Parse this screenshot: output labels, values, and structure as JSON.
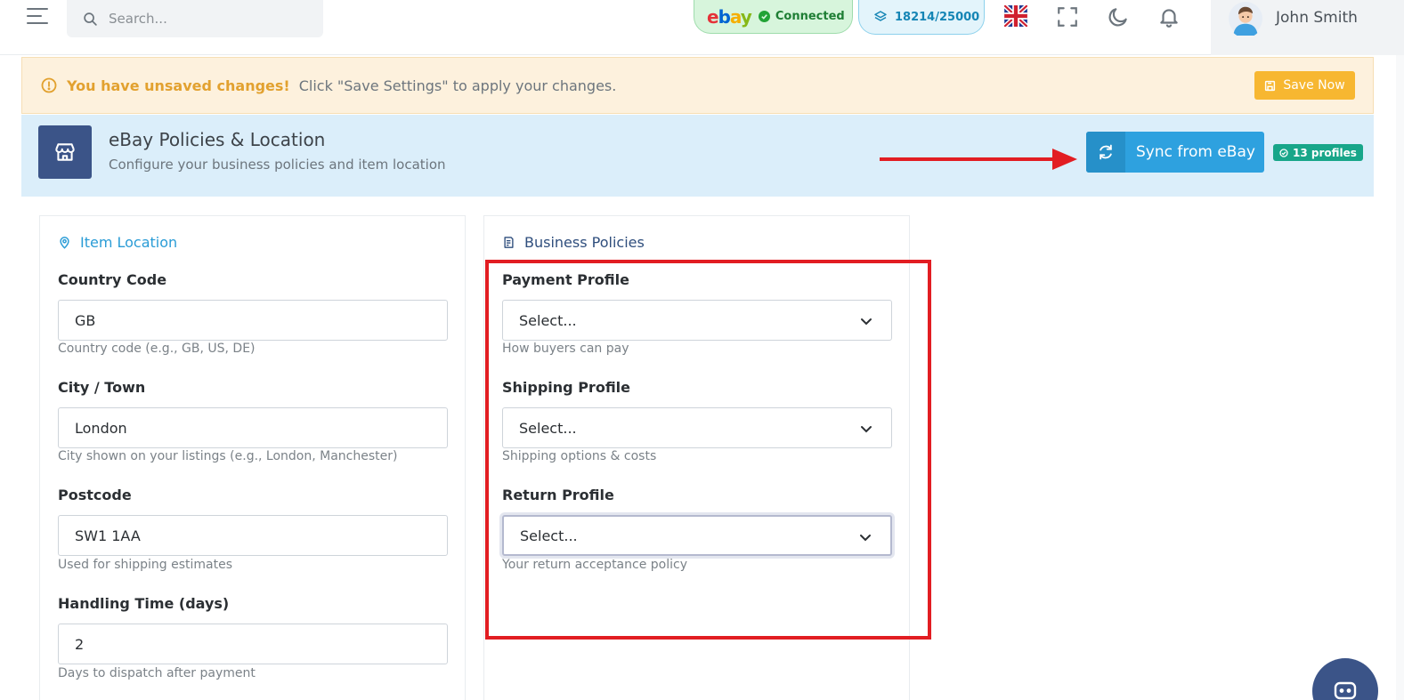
{
  "topbar": {
    "search_placeholder": "Search...",
    "ebay_brand": {
      "e": "e",
      "b": "b",
      "a": "a",
      "y": "y"
    },
    "connection_status": "Connected",
    "quota": "18214/25000",
    "user_name": "John Smith"
  },
  "alert": {
    "strong": "You have unsaved changes!",
    "text": "Click \"Save Settings\" to apply your changes.",
    "save_label": "Save Now"
  },
  "header": {
    "title": "eBay Policies & Location",
    "subtitle": "Configure your business policies and item location",
    "sync_label": "Sync from eBay",
    "profiles_badge": "13 profiles"
  },
  "item_location": {
    "title": "Item Location",
    "fields": [
      {
        "label": "Country Code",
        "value": "GB",
        "help": "Country code (e.g., GB, US, DE)"
      },
      {
        "label": "City / Town",
        "value": "London",
        "help": "City shown on your listings (e.g., London, Manchester)"
      },
      {
        "label": "Postcode",
        "value": "SW1 1AA",
        "help": "Used for shipping estimates"
      },
      {
        "label": "Handling Time (days)",
        "value": "2",
        "help": "Days to dispatch after payment"
      }
    ]
  },
  "business_policies": {
    "title": "Business Policies",
    "fields": [
      {
        "label": "Payment Profile",
        "value": "Select...",
        "help": "How buyers can pay"
      },
      {
        "label": "Shipping Profile",
        "value": "Select...",
        "help": "Shipping options & costs"
      },
      {
        "label": "Return Profile",
        "value": "Select...",
        "help": "Your return acceptance policy"
      }
    ]
  },
  "colors": {
    "accent": "#2ea1df",
    "brand_dark": "#3b5488",
    "warning": "#f7b731",
    "success": "#18a689",
    "annotation_red": "#e21d22"
  },
  "icons": [
    "menu-icon",
    "search-icon",
    "check-circle-icon",
    "layers-icon",
    "uk-flag-icon",
    "fullscreen-icon",
    "moon-icon",
    "bell-icon",
    "avatar",
    "alert-circle-icon",
    "save-icon",
    "store-icon",
    "sync-icon",
    "map-pin-icon",
    "document-icon",
    "chevron-down-icon",
    "chat-icon"
  ]
}
